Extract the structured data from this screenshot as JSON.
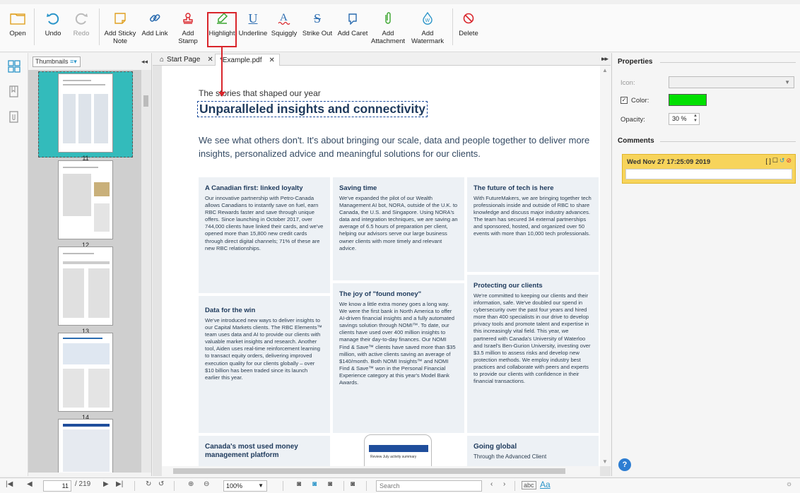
{
  "toolbar": {
    "buttons": [
      {
        "label": "Open",
        "icon": "folder-icon"
      },
      {
        "label": "Undo",
        "icon": "undo-icon"
      },
      {
        "label": "Redo",
        "icon": "redo-icon"
      },
      {
        "label": "Add Sticky Note",
        "icon": "sticky-note-icon"
      },
      {
        "label": "Add Link",
        "icon": "link-icon"
      },
      {
        "label": "Add Stamp",
        "icon": "stamp-icon"
      },
      {
        "label": "Highlight",
        "icon": "highlighter-icon"
      },
      {
        "label": "Underline",
        "icon": "underline-icon"
      },
      {
        "label": "Squiggly",
        "icon": "squiggly-icon"
      },
      {
        "label": "Strike Out",
        "icon": "strikeout-icon"
      },
      {
        "label": "Add Caret",
        "icon": "caret-icon"
      },
      {
        "label": "Add Attachment",
        "icon": "paperclip-icon"
      },
      {
        "label": "Add Watermark",
        "icon": "watermark-icon"
      },
      {
        "label": "Delete",
        "icon": "delete-icon"
      }
    ]
  },
  "thumbnails": {
    "view_select": "Thumbnails",
    "pages": [
      "11",
      "12",
      "13",
      "14"
    ]
  },
  "tabs": [
    {
      "label": "Start Page"
    },
    {
      "label": "*Example.pdf"
    }
  ],
  "page": {
    "kicker": "The stories that shaped our year",
    "headline": "Unparalleled insights and connectivity",
    "intro": "We see what others don't. It's about bringing our scale, data and people together to deliver more insights, personalized advice and meaningful solutions for our clients.",
    "cards": [
      {
        "title": "A Canadian first: linked loyalty",
        "body": "Our innovative partnership with Petro-Canada allows Canadians to instantly save on fuel, earn RBC Rewards faster and save through unique offers. Since launching in October 2017, over 744,000 clients have linked their cards, and we've opened more than 15,800 new credit cards through direct digital channels; 71% of these are new RBC relationships."
      },
      {
        "title": "Saving time",
        "body": "We've expanded the pilot of our Wealth Management AI bot, NORA, outside of the U.K. to Canada, the U.S. and Singapore. Using NORA's data and integration techniques, we are saving an average of 6.5 hours of preparation per client, helping our advisors serve our large business owner clients with more timely and relevant advice."
      },
      {
        "title": "The future of tech is here",
        "body": "With FutureMakers, we are bringing together tech professionals inside and outside of RBC to share knowledge and discuss major industry advances. The team has secured 34 external partnerships and sponsored, hosted, and organized over 50 events with more than 10,000 tech professionals."
      },
      {
        "title": "Data for the win",
        "body": "We've introduced new ways to deliver insights to our Capital Markets clients. The RBC Elements™ team uses data and AI to provide our clients with valuable market insights and research. Another tool, Aiden uses real-time reinforcement learning to transact equity orders, delivering improved execution quality for our clients globally – over $10 billion has been traded since its launch earlier this year."
      },
      {
        "title": "The joy of \"found money\"",
        "body": "We know a little extra money goes a long way. We were the first bank in North America to offer AI-driven financial insights and a fully automated savings solution through NOMI™. To date, our clients have used over 400 million insights to manage their day-to-day finances. Our NOMI Find & Save™ clients have saved more than $35 million, with active clients saving an average of $140/month. Both NOMI Insights™ and NOMI Find & Save™ won in the Personal Financial Experience category at this year's Model Bank Awards."
      },
      {
        "title": "Protecting our clients",
        "body": "We're committed to keeping our clients and their information, safe. We've doubled our spend in cybersecurity over the past four years and hired more than 400 specialists in our drive to develop privacy tools and promote talent and expertise in this increasingly vital field. This year, we partnered with Canada's University of Waterloo and Israel's Ben-Gurion University, investing over $3.5 million to assess risks and develop new protection methods. We employ industry best practices and collaborate with peers and experts to provide our clients with confidence in their financial transactions."
      },
      {
        "title": "Canada's most used money management platform",
        "body": ""
      },
      {
        "title": "Going global",
        "body": "Through the Advanced Client"
      }
    ],
    "phone_text": "Review July activity summary"
  },
  "properties": {
    "title": "Properties",
    "icon_label": "Icon:",
    "color_label": "Color:",
    "color_value": "#00e000",
    "opacity_label": "Opacity:",
    "opacity_value": "30 %"
  },
  "comments": {
    "title": "Comments",
    "items": [
      {
        "date": "Wed Nov 27 17:25:09 2019"
      }
    ]
  },
  "statusbar": {
    "page_current": "11",
    "page_total": "/ 219",
    "zoom": "100%",
    "search_placeholder": "Search"
  },
  "colors": {
    "accent_red": "#d9252b",
    "thumb_selected": "#33bbbb",
    "headline": "#1e3a5c"
  }
}
